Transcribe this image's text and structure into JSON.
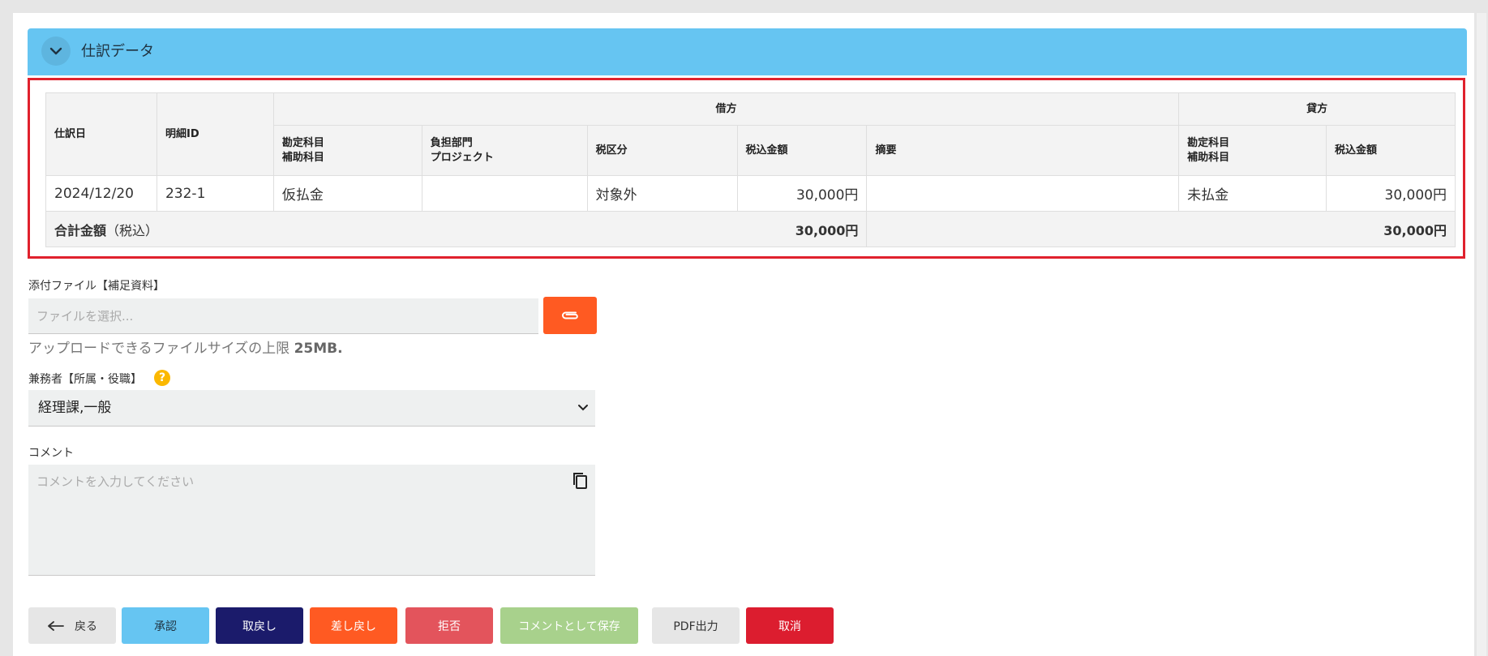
{
  "section": {
    "title": "仕訳データ"
  },
  "table": {
    "headers": {
      "date": "仕訳日",
      "detail_id": "明細ID",
      "debit": "借方",
      "credit": "貸方",
      "debit_account": "勘定科目",
      "debit_sub_account": "補助科目",
      "department": "負担部門",
      "project": "プロジェクト",
      "tax_category": "税区分",
      "debit_amount": "税込金額",
      "memo": "摘要",
      "credit_account": "勘定科目",
      "credit_sub_account": "補助科目",
      "credit_amount": "税込金額"
    },
    "rows": [
      {
        "date": "2024/12/20",
        "detail_id": "232-1",
        "debit_account": "仮払金",
        "department": "",
        "tax_category": "対象外",
        "debit_amount": "30,000円",
        "memo": "",
        "credit_account": "未払金",
        "credit_amount": "30,000円"
      }
    ],
    "total": {
      "label": "合計金額",
      "label_sub": "（税込）",
      "debit_total": "30,000円",
      "credit_total": "30,000円"
    }
  },
  "attachment": {
    "label": "添付ファイル【補足資料】",
    "placeholder": "ファイルを選択...",
    "hint_text": "アップロードできるファイルサイズの上限",
    "hint_size": "25MB."
  },
  "concurrent": {
    "label": "兼務者【所属・役職】",
    "help": "?",
    "selected": "経理課,一般"
  },
  "comment": {
    "label": "コメント",
    "placeholder": "コメントを入力してください"
  },
  "buttons": {
    "back": "戻る",
    "approve": "承認",
    "withdraw": "取戻し",
    "send_back": "差し戻し",
    "reject": "拒否",
    "save_comment": "コメントとして保存",
    "pdf": "PDF出力",
    "cancel": "取消"
  },
  "colors": {
    "header": "#66c5f2",
    "highlight_border": "#e0212d",
    "attach_button": "#ff5a22",
    "help_icon": "#fbb800"
  }
}
